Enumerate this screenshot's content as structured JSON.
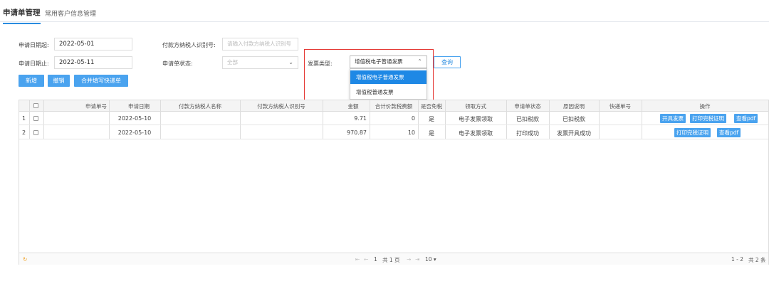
{
  "tabs": [
    {
      "label": "申请单管理"
    },
    {
      "label": "常用客户信息管理"
    }
  ],
  "filters": {
    "start_date_label": "申请日期起:",
    "start_date_value": "2022-05-01",
    "end_date_label": "申请日期止:",
    "end_date_value": "2022-05-11",
    "payer_tax_id_label": "付款方纳税人识别号:",
    "payer_tax_id_placeholder": "请输入付款方纳税人识别号",
    "status_label": "申请单状态:",
    "status_value": "全部",
    "invoice_type_label": "发票类型:",
    "invoice_type_value": "增值税电子普通发票",
    "query_label": "查询"
  },
  "invoice_type_options": [
    "增值税电子普通发票",
    "增值税普通发票"
  ],
  "toolbar": {
    "add_label": "新增",
    "withdraw_label": "撤销",
    "merge_label": "合并填写快递单"
  },
  "table": {
    "headers": [
      "申请单号",
      "申请日期",
      "付款方纳税人名称",
      "付款方纳税人识别号",
      "金额",
      "合计价款税费额",
      "是否免税",
      "领取方式",
      "申请单状态",
      "原因说明",
      "快递单号",
      "操作"
    ],
    "rows": [
      {
        "index": "1",
        "date": "2022-05-10",
        "amount": "9.71",
        "tax": "0",
        "exempt": "是",
        "method": "电子发票领取",
        "status": "已扣税款",
        "reason": "已扣税款",
        "actions": [
          "开具发票",
          "打印完税证明",
          "查看pdf"
        ]
      },
      {
        "index": "2",
        "date": "2022-05-10",
        "amount": "970.87",
        "tax": "10",
        "exempt": "是",
        "method": "电子发票领取",
        "status": "打印成功",
        "reason": "发票开具成功",
        "actions": [
          "打印完税证明",
          "查看pdf"
        ]
      }
    ]
  },
  "pager": {
    "page_input": "1",
    "page_total": "共 1 页",
    "page_size": "10 ▾",
    "range": "1 - 2",
    "total": "共 2 条"
  }
}
